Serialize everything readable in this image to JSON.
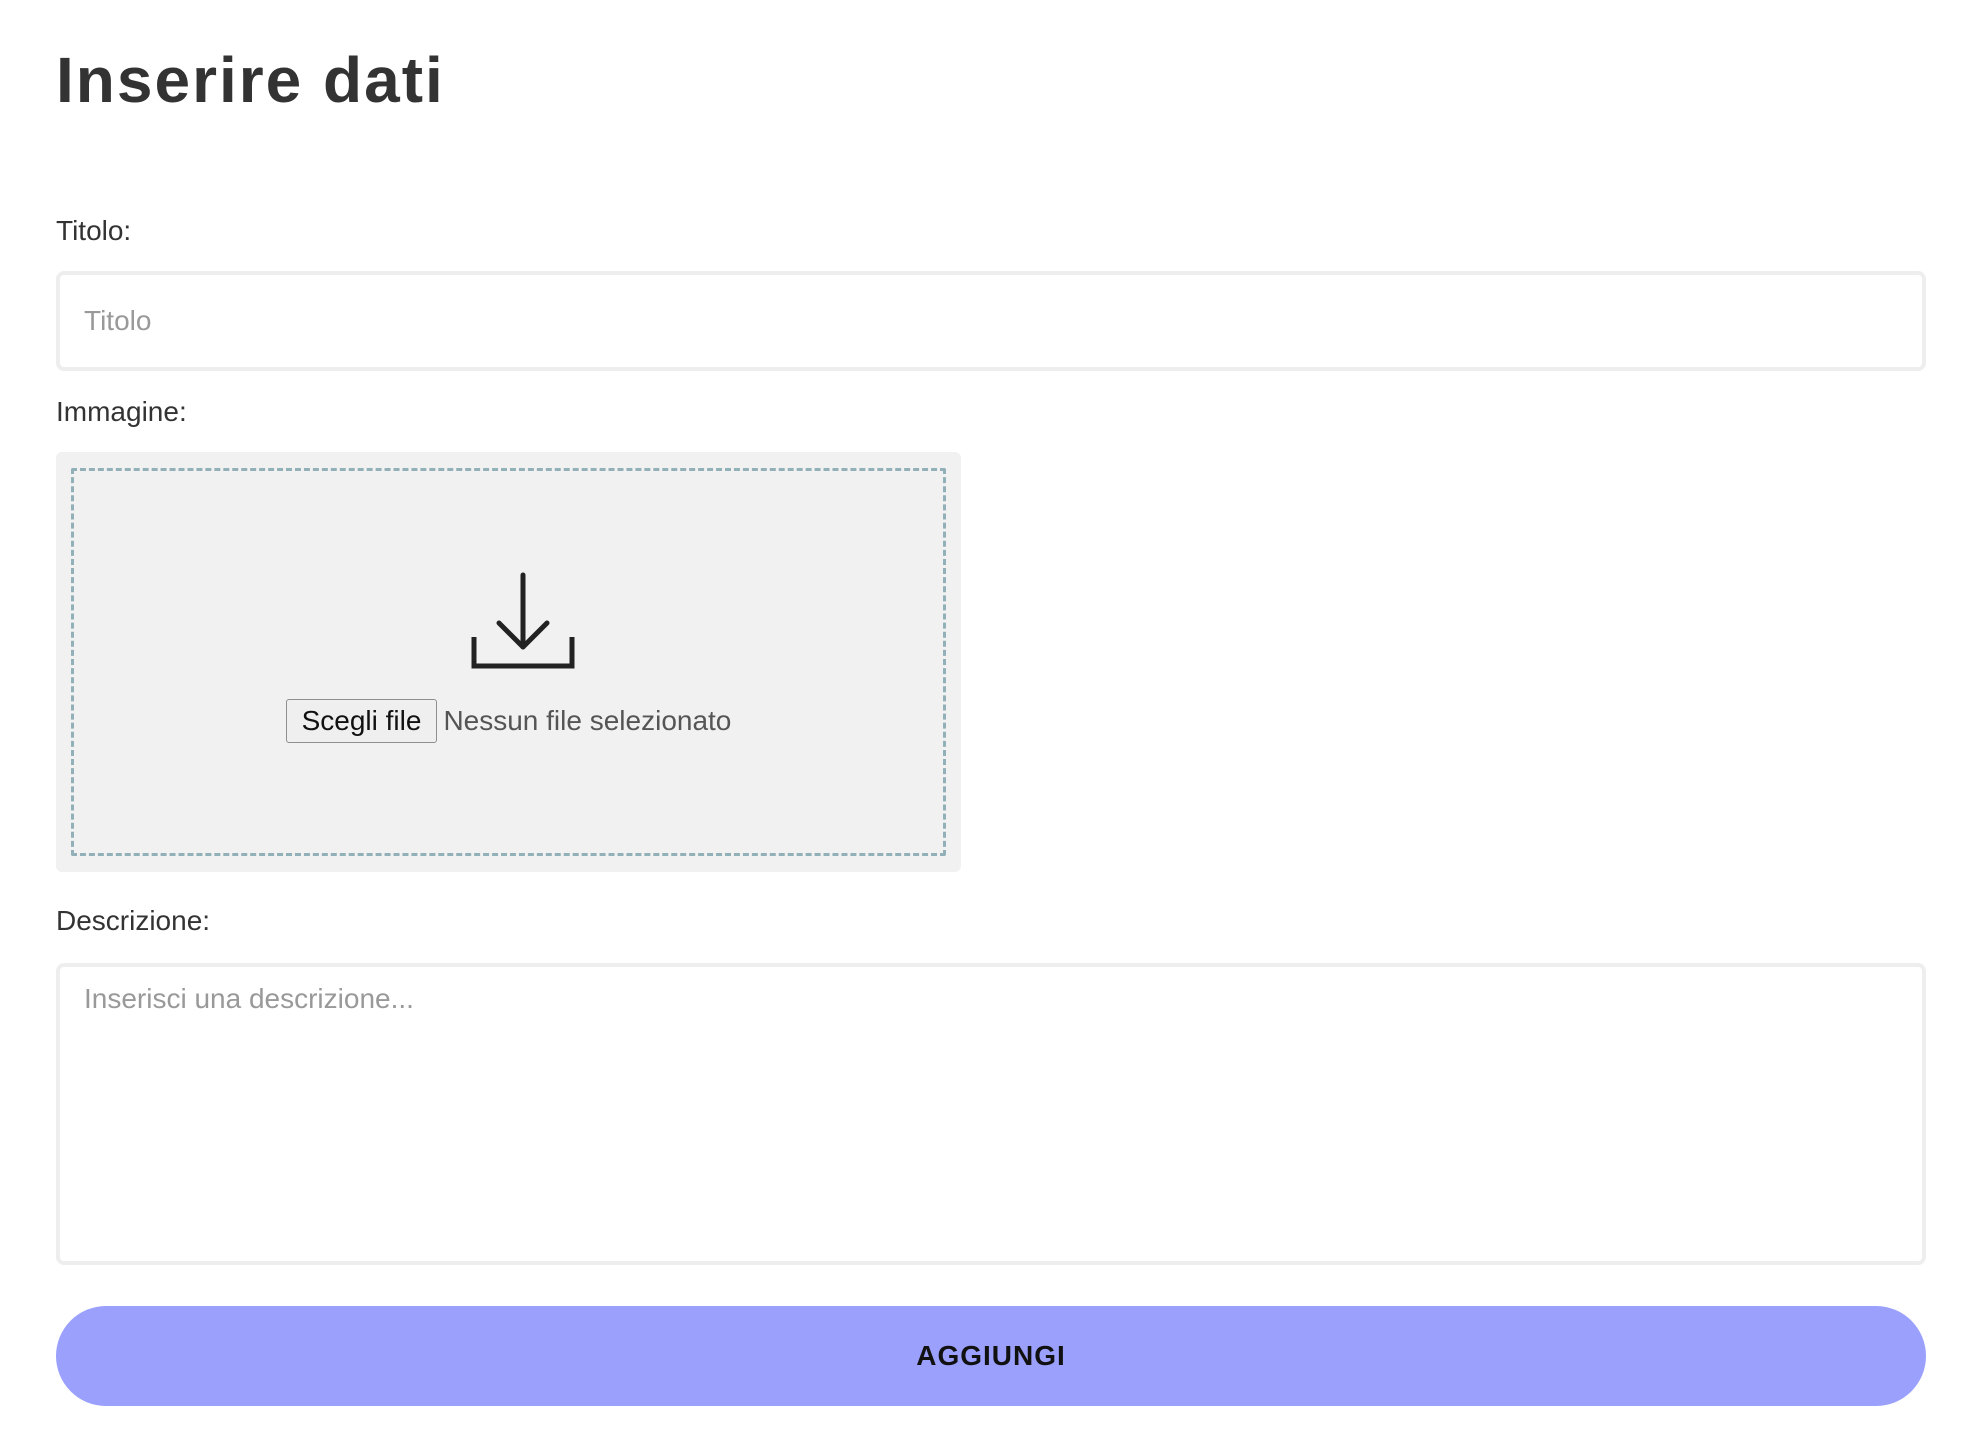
{
  "page": {
    "title": "Inserire dati"
  },
  "form": {
    "title_field": {
      "label": "Titolo:",
      "placeholder": "Titolo",
      "value": ""
    },
    "image_field": {
      "label": "Immagine:",
      "icon": "download-icon",
      "choose_button_label": "Scegli file",
      "status_text": "Nessun file selezionato"
    },
    "description_field": {
      "label": "Descrizione:",
      "placeholder": "Inserisci una descrizione...",
      "value": ""
    },
    "submit": {
      "label": "AGGIUNGI"
    }
  },
  "colors": {
    "submit_background": "#9aa0fc",
    "dropzone_background": "#f1f1f1",
    "dropzone_border": "#92b0b8",
    "text": "#333333"
  }
}
